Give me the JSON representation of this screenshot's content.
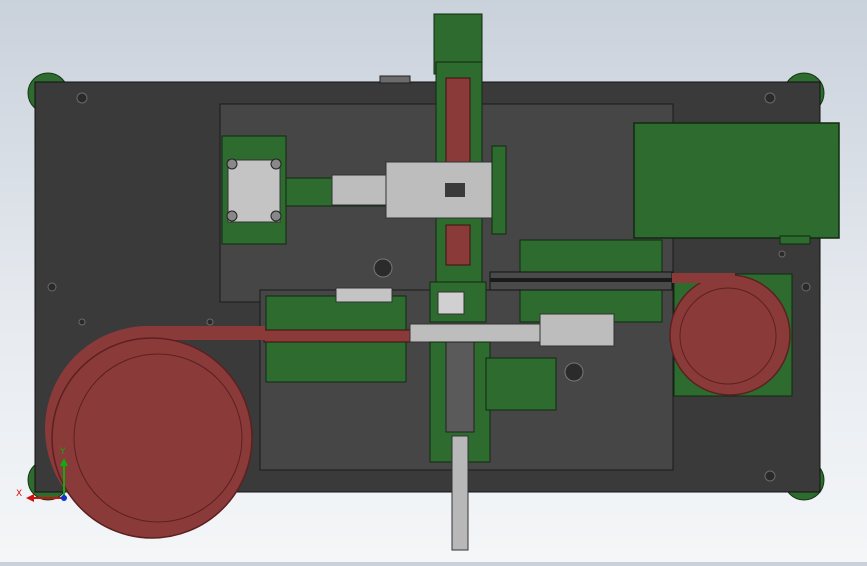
{
  "viewport": {
    "colors": {
      "background_top": "#c9d1db",
      "background_bottom": "#f4f6f8",
      "base_plate": "#3a3a3a",
      "sub_plate": "#464646",
      "green_part": "#2e6b2e",
      "green_dark": "#1f4d1f",
      "red_coil": "#8b3a3a",
      "red_coil_edge": "#5c2020",
      "steel": "#b8b8b8"
    }
  },
  "triad": {
    "x_label": "X",
    "y_label": "Y",
    "x_color": "#cc1111",
    "y_color": "#11aa11",
    "z_color": "#1133cc"
  }
}
